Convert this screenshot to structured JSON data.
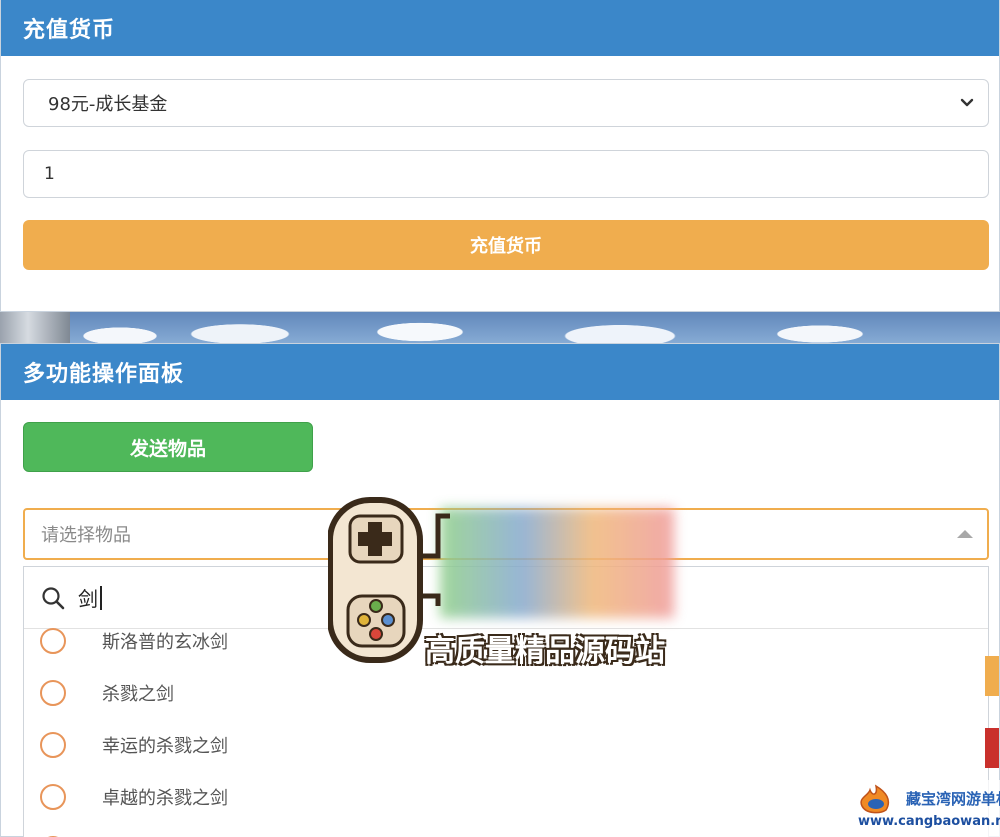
{
  "recharge_panel": {
    "title": "充值货币",
    "package_select": {
      "value": "98元-成长基金"
    },
    "amount_input": {
      "value": "1"
    },
    "submit_label": "充值货币"
  },
  "multi_panel": {
    "title": "多功能操作面板",
    "send_button_label": "发送物品",
    "item_select": {
      "placeholder": "请选择物品",
      "search_query": "剑",
      "options": [
        {
          "label": "斯洛普的玄冰剑"
        },
        {
          "label": "杀戮之剑"
        },
        {
          "label": "幸运的杀戮之剑"
        },
        {
          "label": "卓越的杀戮之剑"
        }
      ]
    }
  },
  "watermark": {
    "center_text": "高质量精品源码站",
    "corner_text": "藏宝湾网游单机",
    "corner_url": "www.cangbaowan.net"
  },
  "colors": {
    "header_blue": "#3b87c9",
    "button_orange": "#f0ad4e",
    "button_green": "#4fb85a",
    "radio_orange": "#e8955a"
  }
}
